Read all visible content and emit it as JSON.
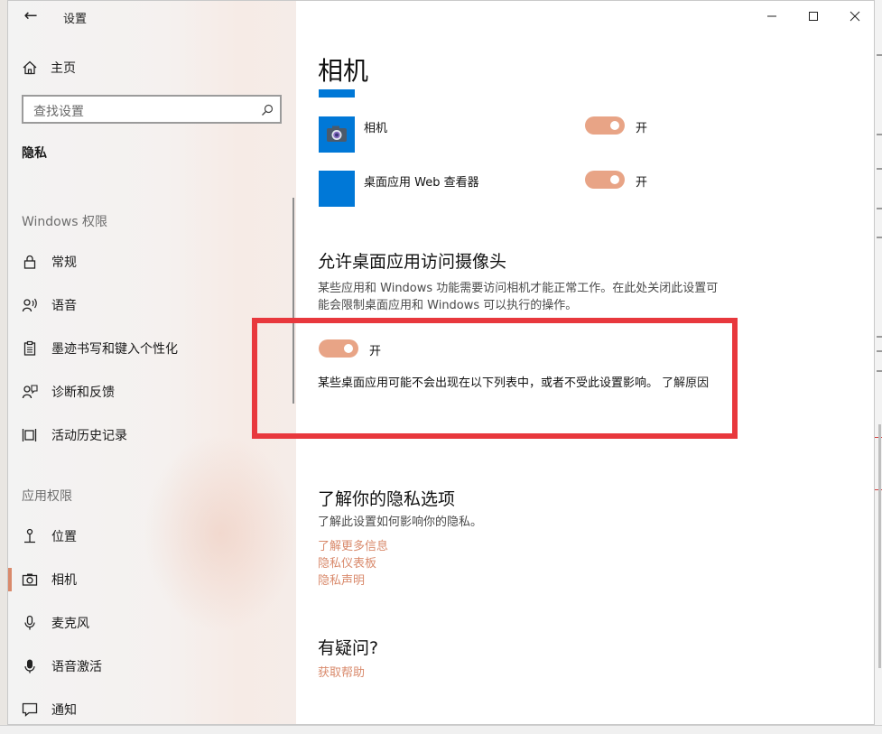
{
  "window": {
    "title": "设置"
  },
  "controls": {
    "back": "←",
    "minimize": "—",
    "maximize": "☐",
    "close": "✕"
  },
  "sidebar": {
    "home_label": "主页",
    "search_placeholder": "查找设置",
    "section_title": "隐私",
    "groups": [
      {
        "title": "Windows 权限",
        "items": [
          {
            "label": "常规",
            "icon": "lock-icon"
          },
          {
            "label": "语音",
            "icon": "speech-icon"
          },
          {
            "label": "墨迹书写和键入个性化",
            "icon": "clipboard-icon"
          },
          {
            "label": "诊断和反馈",
            "icon": "feedback-icon"
          },
          {
            "label": "活动历史记录",
            "icon": "timeline-icon"
          }
        ]
      },
      {
        "title": "应用权限",
        "items": [
          {
            "label": "位置",
            "icon": "location-icon"
          },
          {
            "label": "相机",
            "icon": "camera-icon",
            "active": true
          },
          {
            "label": "麦克风",
            "icon": "microphone-icon"
          },
          {
            "label": "语音激活",
            "icon": "voice-activation-icon"
          },
          {
            "label": "通知",
            "icon": "notification-icon"
          }
        ]
      }
    ]
  },
  "main": {
    "title": "相机",
    "apps": [
      {
        "name": "相机",
        "toggle_on": true,
        "state_label": "开",
        "icon": "camera-app-icon"
      },
      {
        "name": "桌面应用 Web 查看器",
        "toggle_on": true,
        "state_label": "开",
        "icon": "app-tile-icon"
      }
    ],
    "desktop": {
      "heading": "允许桌面应用访问摄像头",
      "description": "某些应用和 Windows 功能需要访问相机才能正常工作。在此处关闭此设置可能会限制桌面应用和 Windows 可以执行的操作。",
      "toggle_on": true,
      "state_label": "开",
      "note": "某些桌面应用可能不会出现在以下列表中，或者不受此设置影响。",
      "learn_why": "了解原因"
    },
    "privacy": {
      "heading": "了解你的隐私选项",
      "description": "了解此设置如何影响你的隐私。",
      "links": [
        "了解更多信息",
        "隐私仪表板",
        "隐私声明"
      ]
    },
    "help": {
      "heading": "有疑问?",
      "link": "获取帮助"
    }
  },
  "colors": {
    "accent": "#d98a6c",
    "toggle": "#e8a486",
    "tile_blue": "#0078d7",
    "highlight": "#e8383d"
  }
}
